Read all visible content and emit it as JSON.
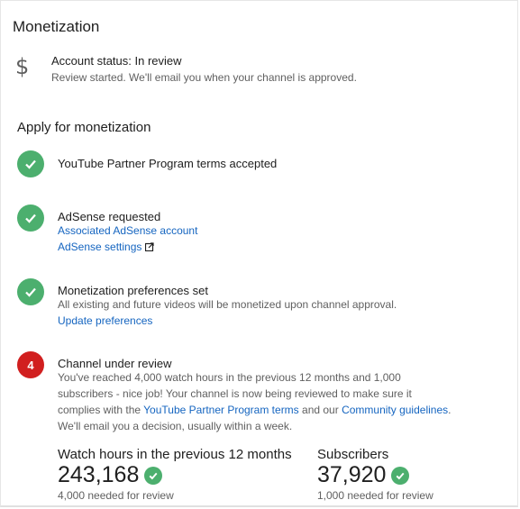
{
  "header": {
    "title": "Monetization"
  },
  "account": {
    "icon": "dollar-icon",
    "status": "Account status: In review",
    "subtitle": "Review started. We'll email you when your channel is approved."
  },
  "apply": {
    "title": "Apply for monetization",
    "steps": [
      {
        "title": "YouTube Partner Program terms accepted",
        "state": "complete"
      },
      {
        "title": "AdSense requested",
        "state": "complete",
        "links": [
          "Associated AdSense account",
          "AdSense settings"
        ]
      },
      {
        "title": "Monetization preferences set",
        "state": "complete",
        "description": "All existing and future videos will be monetized upon channel approval.",
        "links": [
          "Update preferences"
        ]
      },
      {
        "title": "Channel under review",
        "state": "in-progress",
        "number": "4",
        "line1": "You've reached 4,000 watch hours in the previous 12 months and 1,000",
        "line2": "subscribers - nice job! Your channel is now being reviewed to make sure it",
        "line3_prefix": "complies with the ",
        "line3_link1": "YouTube Partner Program terms",
        "line3_mid": " and our ",
        "line3_link2": "Community guidelines",
        "line3_suffix": ".",
        "line4": "We'll email you a decision, usually within a week."
      }
    ]
  },
  "stats": {
    "watch_hours": {
      "label": "Watch hours in the previous 12 months",
      "value": "243,168",
      "note": "4,000 needed for review"
    },
    "subscribers": {
      "label": "Subscribers",
      "value": "37,920",
      "note": "1,000 needed for review"
    }
  },
  "colors": {
    "success": "#4caf6e",
    "alert": "#d11f1f",
    "link": "#1565c0"
  }
}
